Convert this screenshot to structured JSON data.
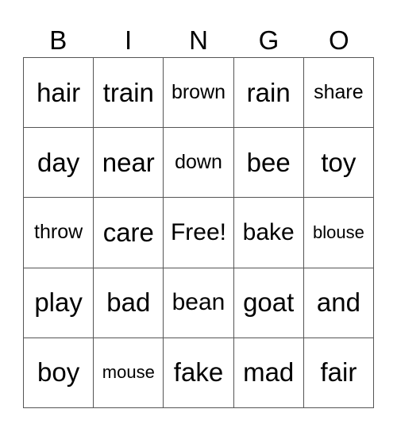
{
  "header": [
    "B",
    "I",
    "N",
    "G",
    "O"
  ],
  "cells": [
    [
      {
        "text": "hair",
        "size": "lg"
      },
      {
        "text": "train",
        "size": "lg"
      },
      {
        "text": "brown",
        "size": "sm"
      },
      {
        "text": "rain",
        "size": "lg"
      },
      {
        "text": "share",
        "size": "sm"
      }
    ],
    [
      {
        "text": "day",
        "size": "lg"
      },
      {
        "text": "near",
        "size": "lg"
      },
      {
        "text": "down",
        "size": "sm"
      },
      {
        "text": "bee",
        "size": "lg"
      },
      {
        "text": "toy",
        "size": "lg"
      }
    ],
    [
      {
        "text": "throw",
        "size": "sm"
      },
      {
        "text": "care",
        "size": "lg"
      },
      {
        "text": "Free!",
        "size": "md"
      },
      {
        "text": "bake",
        "size": "md"
      },
      {
        "text": "blouse",
        "size": "xs"
      }
    ],
    [
      {
        "text": "play",
        "size": "lg"
      },
      {
        "text": "bad",
        "size": "lg"
      },
      {
        "text": "bean",
        "size": "md"
      },
      {
        "text": "goat",
        "size": "lg"
      },
      {
        "text": "and",
        "size": "lg"
      }
    ],
    [
      {
        "text": "boy",
        "size": "lg"
      },
      {
        "text": "mouse",
        "size": "xs"
      },
      {
        "text": "fake",
        "size": "lg"
      },
      {
        "text": "mad",
        "size": "lg"
      },
      {
        "text": "fair",
        "size": "lg"
      }
    ]
  ]
}
